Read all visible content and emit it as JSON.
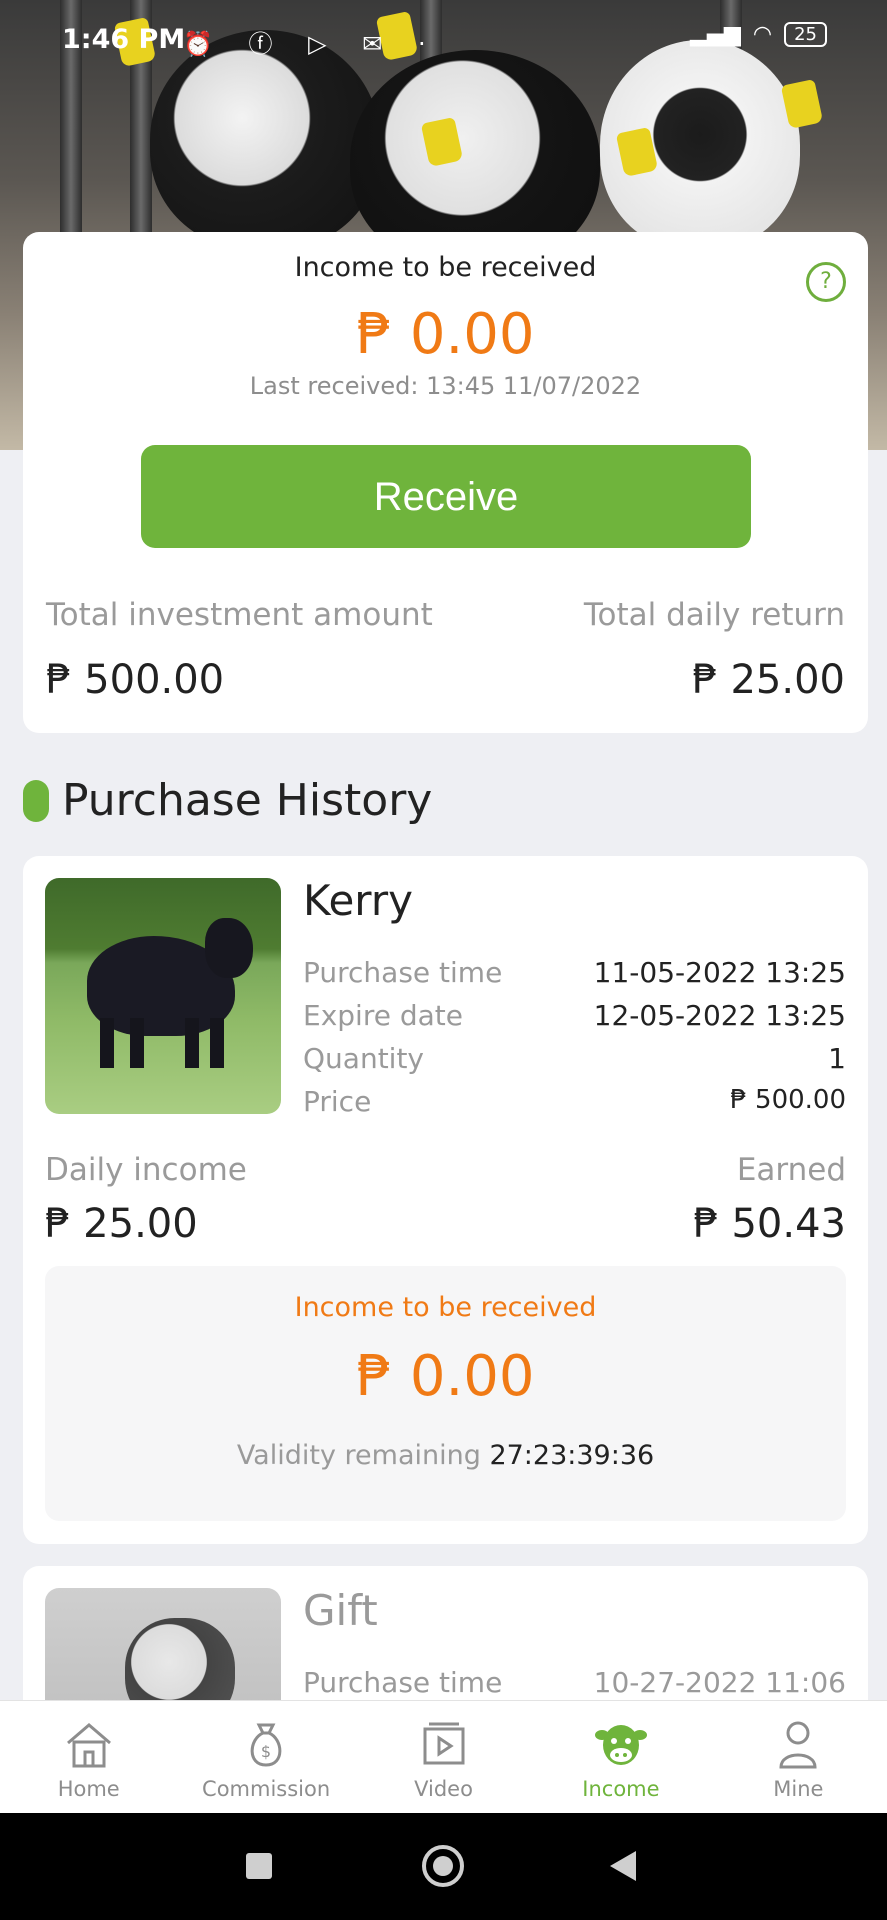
{
  "status_bar": {
    "time": "1:46 PM",
    "battery": "25"
  },
  "summary": {
    "title": "Income to be received",
    "amount": "₱ 0.00",
    "last_received": "Last received: 13:45 11/07/2022",
    "receive_label": "Receive",
    "total_investment_label": "Total investment amount",
    "total_investment_value": "₱ 500.00",
    "total_daily_label": "Total daily return",
    "total_daily_value": "₱ 25.00",
    "help_glyph": "?"
  },
  "section": {
    "title": "Purchase History"
  },
  "purchases": [
    {
      "name": "Kerry",
      "rows": [
        {
          "label": "Purchase time",
          "value": "11-05-2022 13:25"
        },
        {
          "label": "Expire date",
          "value": "12-05-2022 13:25"
        },
        {
          "label": "Quantity",
          "value": "1"
        },
        {
          "label": "Price",
          "value": "₱ 500.00"
        }
      ],
      "daily_income_label": "Daily income",
      "daily_income_value": "₱ 25.00",
      "earned_label": "Earned",
      "earned_value": "₱ 50.43",
      "income_title": "Income to be received",
      "income_amount": "₱ 0.00",
      "validity_label": "Validity remaining",
      "validity_value": "27:23:39:36"
    },
    {
      "name": "Gift",
      "rows": [
        {
          "label": "Purchase time",
          "value": "10-27-2022 11:06"
        }
      ]
    }
  ],
  "nav": [
    {
      "label": "Home",
      "icon": "home-icon"
    },
    {
      "label": "Commission",
      "icon": "money-bag-icon"
    },
    {
      "label": "Video",
      "icon": "video-icon"
    },
    {
      "label": "Income",
      "icon": "cow-face-icon",
      "active": true
    },
    {
      "label": "Mine",
      "icon": "person-icon"
    }
  ],
  "colors": {
    "accent_green": "#6fb43c",
    "amount_orange": "#f07a15"
  }
}
